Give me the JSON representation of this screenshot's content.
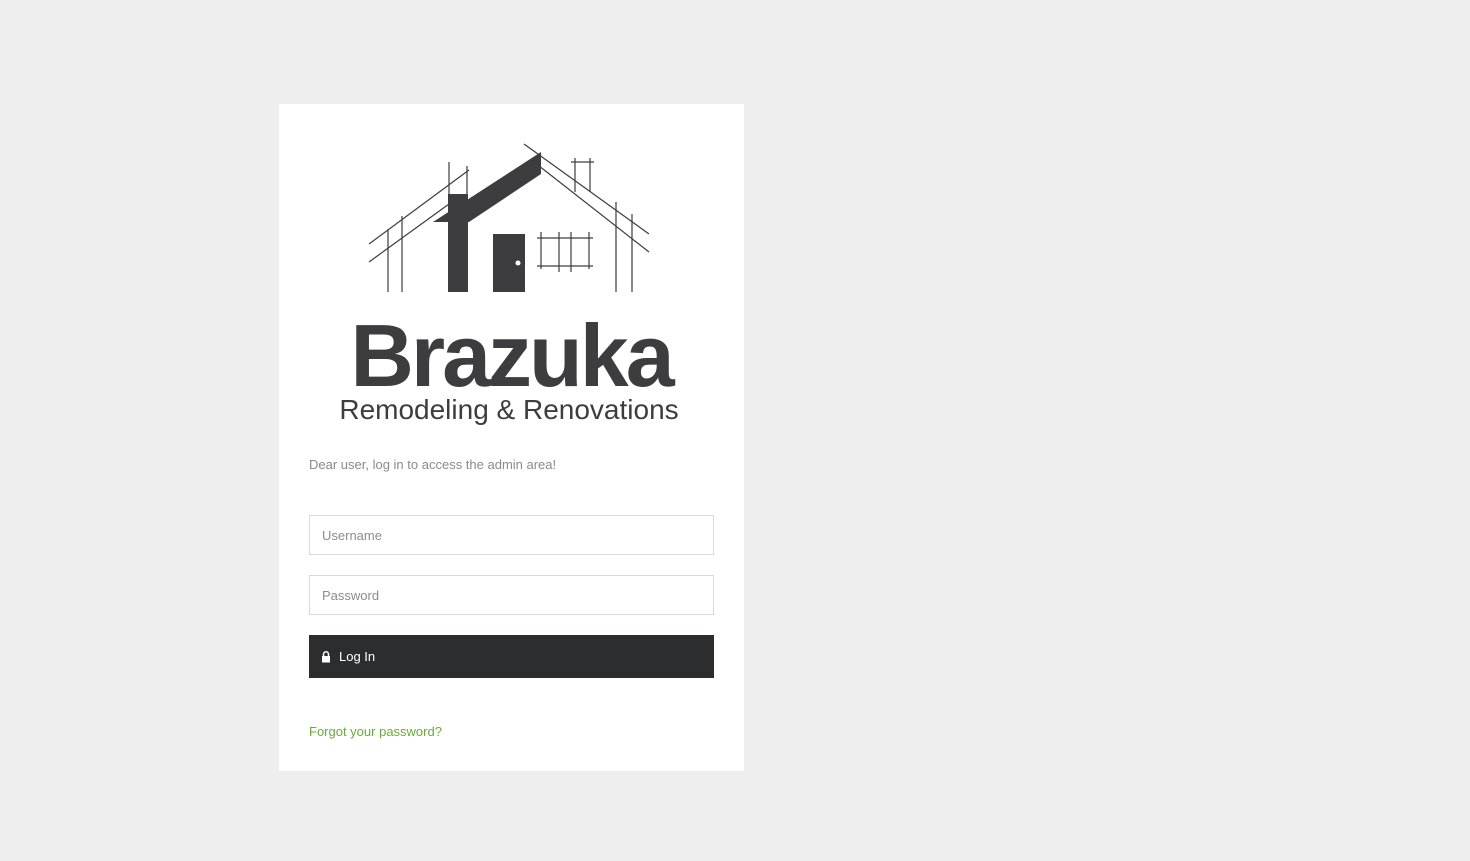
{
  "brand": {
    "name": "Brazuka",
    "tagline": "Remodeling & Renovations",
    "color": "#3d3d3f"
  },
  "login": {
    "intro": "Dear user, log in to access the admin area!",
    "username_placeholder": "Username",
    "password_placeholder": "Password",
    "button_label": "Log In",
    "button_icon": "lock-icon",
    "forgot_label": "Forgot your password?",
    "accent_color": "#6aaa3a"
  }
}
